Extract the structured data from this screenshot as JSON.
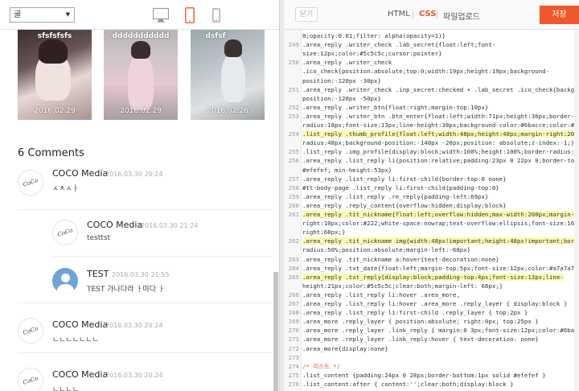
{
  "left_toolbar": {
    "font_select": "굴",
    "devices": [
      "desktop-icon",
      "tablet-icon",
      "mobile-icon"
    ],
    "active_device": "tablet"
  },
  "gallery": [
    {
      "title": "sfsfsfsfs",
      "date": "2016.02.29"
    },
    {
      "title": "ddddddddddd",
      "date": "2016.02.29"
    },
    {
      "title": "dsfsf",
      "date": "2016.02.26"
    }
  ],
  "comments": {
    "title": "6 Comments",
    "items": [
      {
        "name": "COCO Media",
        "date": "2016.03.30 20:24",
        "text": "ㅅㅊㅅㅏ",
        "avatar": "coco"
      },
      {
        "name": "COCO Media",
        "date": "2016.03.30 21:24",
        "text": "testtst",
        "avatar": "coco"
      },
      {
        "name": "TEST",
        "date": "2016.03.30 21:55",
        "text": "TEST 가나다라 ㅏ마다 ㅏ",
        "avatar": "person"
      },
      {
        "name": "COCO Media",
        "date": "2016.03.30 20:24",
        "text": "ㄴㄴㄴㄴㄴㄴㄴ",
        "avatar": "coco"
      },
      {
        "name": "COCO Media",
        "date": "2016.03.30 20:24",
        "text": "ㄴㄴㄴㄴ",
        "avatar": "coco"
      }
    ],
    "avatar_logo": "CoCo"
  },
  "right_toolbar": {
    "close_label": "닫기",
    "tabs": [
      "HTML",
      "CSS",
      "파일업로드"
    ],
    "active_tab": "CSS",
    "save_label": "저장"
  },
  "colors": {
    "accent": "#f0572a",
    "active_tab": "#e85a23",
    "highlight": "#fbfbb0"
  },
  "code_lines": [
    {
      "n": "",
      "code": "0;opacity:0.01;filter: alpha(opacity=1)}"
    },
    {
      "n": "249",
      "code": ".area_reply .writer_check .lab_secret{float:left;font-"
    },
    {
      "n": "",
      "code": "size:12px;color:#5c5c5c;cursor:pointer}"
    },
    {
      "n": "250",
      "code": ".area_reply .writer_check"
    },
    {
      "n": "",
      "code": ".ico_check{position:absolute;top:0;width:19px;height:19px;background-"
    },
    {
      "n": "",
      "code": "position:-120px -30px}"
    },
    {
      "n": "251",
      "code": ".area_reply .writer_check .inp_secret:checked + .lab_secret .ico_check{background-"
    },
    {
      "n": "",
      "code": "position:-120px -50px}"
    },
    {
      "n": "252",
      "code": ".area_reply .writer_btn{float:right;margin-top:10px}"
    },
    {
      "n": "253",
      "code": ".area_reply .writer_btn .btn_enter{float:left;width:71px;height:36px;border-"
    },
    {
      "n": "",
      "code": "radius:18px;font-size:13px;line-height:38px;background-color:#6bacce;color:#fff}"
    },
    {
      "n": "254",
      "code": ".list_reply .thumb_profile{float:left;width:48px;height:48px;margin-right:20px;border-",
      "hl": true
    },
    {
      "n": "",
      "code": "radius:48px;background-position:-140px -20px;position: absolute;z-index:-1;}"
    },
    {
      "n": "255",
      "code": ".list_reply .img_profile{display:block;width:100%;height:100%;border-radius:48px;}"
    },
    {
      "n": "256",
      "code": ".area_reply .list_reply li{position:relative;padding:23px 0 22px 0;border-top:1px solid"
    },
    {
      "n": "",
      "code": "#efefef; min-height:53px}"
    },
    {
      "n": "257",
      "code": ".area_reply .list_reply li:first-child{border-top:0 none}"
    },
    {
      "n": "258",
      "code": "#tt-body-page .list_reply li:first-child{padding-top:0}"
    },
    {
      "n": "259",
      "code": ".area_reply .list_reply .re_reply{padding-left:69px}"
    },
    {
      "n": "260",
      "code": ".area_reply .reply_content{overflow:hidden;display:block}"
    },
    {
      "n": "261",
      "code": ".area_reply .tit_nickname{float:left;overflow:hidden;max-width:200px;margin-",
      "hl": true
    },
    {
      "n": "",
      "code": "right:10px;color:#222;white-space:nowrap;text-overflow:ellipsis;font-size:16px;margin-"
    },
    {
      "n": "",
      "code": "right:68px;}"
    },
    {
      "n": "262",
      "code": ".area_reply .tit_nickname img{width:48px!important;height:48px!important;border-",
      "hl": true
    },
    {
      "n": "",
      "code": "radius:50%;position:absolute;margin-left:-68px}"
    },
    {
      "n": "263",
      "code": ".area_reply .tit_nickname a:hover{text-decoration:none}"
    },
    {
      "n": "264",
      "code": ".area_reply .txt_date{float:left;margin-top:5px;font-size:12px;color:#a7a7a7}"
    },
    {
      "n": "265",
      "code": ".area_reply .txt_reply{display:block;padding-top:4px;font-size:13px;line-",
      "hl": true
    },
    {
      "n": "",
      "code": "height:21px;color:#5c5c5c;clear:both;margin-left: 68px;}"
    },
    {
      "n": "266",
      "code": ".area_reply .list_reply li:hover .area_more,"
    },
    {
      "n": "267",
      "code": ".area_reply .list_reply li:hover .area_more .reply_layer { display:block }"
    },
    {
      "n": "268",
      "code": ".area_reply .list_reply li:first-child .reply_layer { top:2px }"
    },
    {
      "n": "269",
      "code": ".area_more .reply_layer { position:absolute; right:0px; top:25px }"
    },
    {
      "n": "270",
      "code": ".area_more .reply_layer .link_reply { margin:0 3px;font-size:12px;color:#6bacce }"
    },
    {
      "n": "271",
      "code": ".area_more .reply_layer .link_reply:hover { text-decoration: none}"
    },
    {
      "n": "272",
      "code": ".area_more{display:none}"
    },
    {
      "n": "273",
      "code": ""
    },
    {
      "n": "274",
      "code": "/* 리스트 */",
      "comment": true
    },
    {
      "n": "275",
      "code": ".list_content {padding:24px 0 28px;border-bottom:1px solid #efefef }"
    },
    {
      "n": "276",
      "code": ".list_content:after { content:'';clear:both;display:block }"
    }
  ]
}
